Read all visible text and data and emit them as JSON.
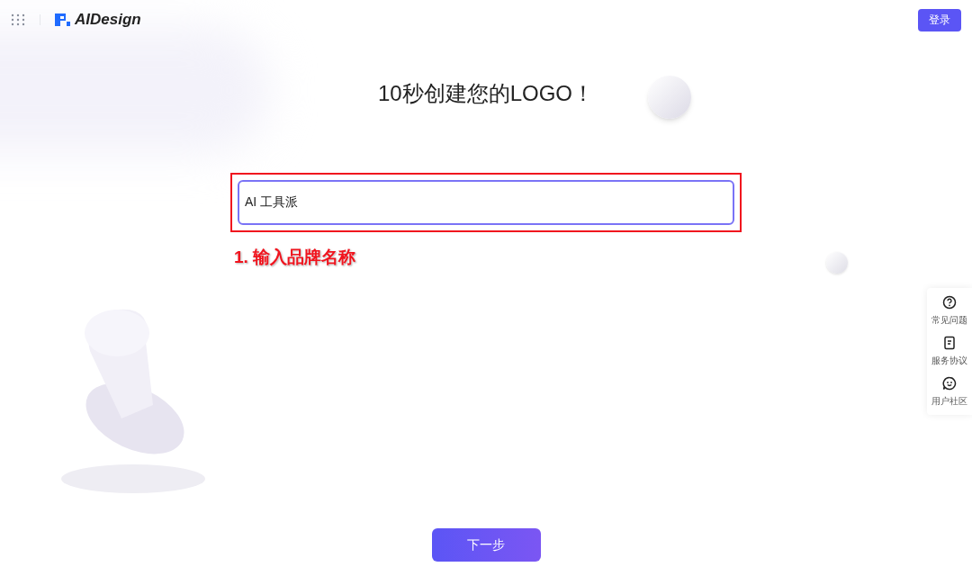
{
  "header": {
    "brand": "AIDesign",
    "login_button": "登录"
  },
  "title": "10秒创建您的LOGO！",
  "brand_input": {
    "value": "AI 工具派"
  },
  "annotation": {
    "text": "1. 输入品牌名称"
  },
  "side_panel": [
    {
      "kind": "help",
      "label": "常见问题"
    },
    {
      "kind": "document",
      "label": "服务协议"
    },
    {
      "kind": "community",
      "label": "用户社区"
    }
  ],
  "next_button": "下一步"
}
